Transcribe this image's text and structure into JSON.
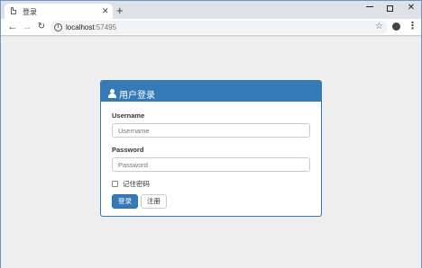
{
  "browser": {
    "tab_title": "登录",
    "tab_close": "✕",
    "new_tab": "+",
    "url_host": "localhost",
    "url_port": ":57495",
    "window_controls": {
      "minimize": "minimize-icon",
      "maximize": "maximize-icon",
      "close": "✕"
    },
    "nav": {
      "back": "←",
      "forward": "→",
      "reload": "↻",
      "star": "☆",
      "menu": "⋮"
    }
  },
  "login": {
    "heading": "用户登录",
    "username_label": "Username",
    "username_placeholder": "Username",
    "password_label": "Password",
    "password_placeholder": "Password",
    "remember_label": "记住密码",
    "login_button": "登录",
    "register_button": "注册"
  },
  "colors": {
    "primary": "#337ab7",
    "page_bg": "#eeeeee",
    "chrome_bg": "#dee1e6"
  }
}
